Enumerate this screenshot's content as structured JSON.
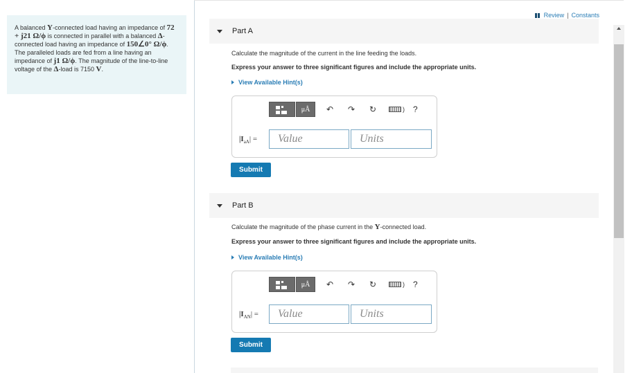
{
  "problem": {
    "segments": [
      {
        "t": "A balanced ",
        "m": false
      },
      {
        "t": "Y",
        "m": true
      },
      {
        "t": "-connected load having an impedance of ",
        "m": false
      },
      {
        "t": "72 + j21 Ω/ϕ",
        "m": true
      },
      {
        "t": " is connected in parallel with a balanced ",
        "m": false
      },
      {
        "t": "Δ",
        "m": true
      },
      {
        "t": "-connected load having an impedance of ",
        "m": false
      },
      {
        "t": "150∠0° Ω/ϕ",
        "m": true
      },
      {
        "t": ". The paralleled loads are fed from a line having an impedance of ",
        "m": false
      },
      {
        "t": "j1 Ω/ϕ",
        "m": true
      },
      {
        "t": ". The magnitude of the line-to-line voltage of the ",
        "m": false
      },
      {
        "t": "Δ",
        "m": true
      },
      {
        "t": "-load is 7150 ",
        "m": false
      },
      {
        "t": "V",
        "m": true
      },
      {
        "t": ".",
        "m": false
      }
    ]
  },
  "top_links": {
    "review": "Review",
    "separator": "|",
    "constants": "Constants"
  },
  "parts": [
    {
      "title": "Part A",
      "question_pre": "Calculate the magnitude of the current in the line feeding the loads.",
      "question_math": "",
      "question_post": "",
      "express": "Express your answer to three significant figures and include the appropriate units.",
      "hint": "View Available Hint(s)",
      "label_main": "|I",
      "label_sub": "aA",
      "label_end": "| =",
      "value_placeholder": "Value",
      "units_placeholder": "Units",
      "submit": "Submit"
    },
    {
      "title": "Part B",
      "question_pre": "Calculate the magnitude of the phase current in the ",
      "question_math": "Y",
      "question_post": "-connected load.",
      "express": "Express your answer to three significant figures and include the appropriate units.",
      "hint": "View Available Hint(s)",
      "label_main": "|I",
      "label_sub": "AN",
      "label_end": "| =",
      "value_placeholder": "Value",
      "units_placeholder": "Units",
      "submit": "Submit"
    }
  ],
  "toolbar": {
    "units_symbol": "μÅ",
    "help": "?",
    "keyboard_paren": ")"
  }
}
